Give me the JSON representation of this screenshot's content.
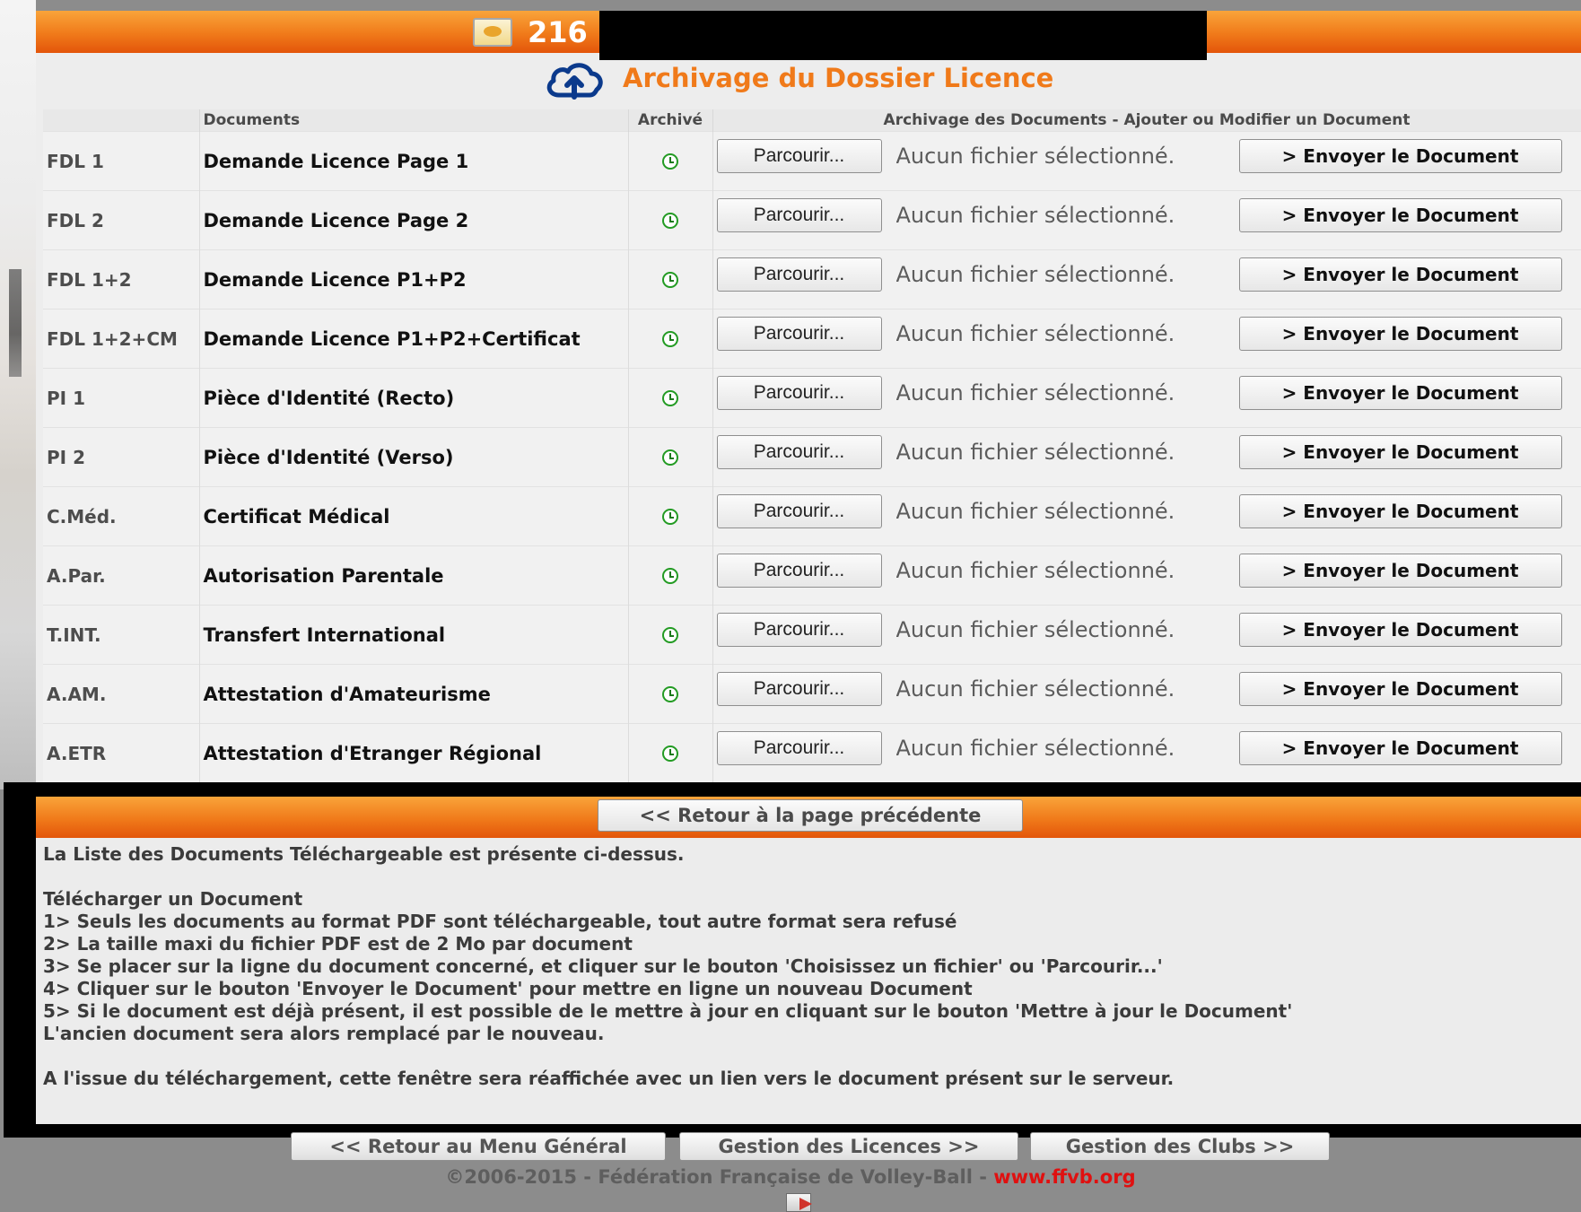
{
  "header": {
    "title_visible": "216",
    "subtitle": "Archivage du Dossier Licence"
  },
  "table": {
    "headers": {
      "code": "",
      "documents": "Documents",
      "archived": "Archivé",
      "actions": "Archivage des Documents - Ajouter ou Modifier un Document"
    },
    "browse_label": "Parcourir...",
    "no_file_label": "Aucun fichier sélectionné.",
    "send_label": "> Envoyer le Document",
    "rows": [
      {
        "code": "FDL 1",
        "label": "Demande Licence Page 1"
      },
      {
        "code": "FDL 2",
        "label": "Demande Licence Page 2"
      },
      {
        "code": "FDL 1+2",
        "label": "Demande Licence P1+P2"
      },
      {
        "code": "FDL 1+2+CM",
        "label": "Demande Licence P1+P2+Certificat"
      },
      {
        "code": "PI 1",
        "label": "Pièce d'Identité (Recto)"
      },
      {
        "code": "PI 2",
        "label": "Pièce d'Identité (Verso)"
      },
      {
        "code": "C.Méd.",
        "label": "Certificat Médical"
      },
      {
        "code": "A.Par.",
        "label": "Autorisation Parentale"
      },
      {
        "code": "T.INT.",
        "label": "Transfert International"
      },
      {
        "code": "A.AM.",
        "label": "Attestation d'Amateurisme"
      },
      {
        "code": "A.ETR",
        "label": "Attestation d'Etranger Régional"
      }
    ]
  },
  "info": {
    "back_button": "<< Retour à la page précédente",
    "intro": "La Liste des Documents Téléchargeable est présente ci-dessus.",
    "heading": "Télécharger un Document",
    "steps": [
      "1> Seuls les documents au format PDF sont téléchargeable, tout autre format sera refusé",
      "2> La taille maxi du fichier PDF est de 2 Mo par document",
      "3> Se placer sur la ligne du document concerné, et cliquer sur le bouton 'Choisissez un fichier' ou 'Parcourir...'",
      "4> Cliquer sur le bouton 'Envoyer le Document' pour mettre en ligne un nouveau Document",
      "5> Si le document est déjà présent, il est possible de le mettre à jour en cliquant sur le bouton 'Mettre à jour le Document'"
    ],
    "replace_note": "L'ancien document sera alors remplacé par le nouveau.",
    "outro": "A l'issue du téléchargement, cette fenêtre sera réaffichée avec un lien vers le document présent sur le serveur."
  },
  "footer": {
    "menu_button": "<< Retour au Menu Général",
    "licences_button": "Gestion des Licences >>",
    "clubs_button": "Gestion des Clubs >>",
    "copyright": "©2006-2015 - Fédération Française de Volley-Ball - ",
    "site_link": "www.ffvb.org"
  },
  "colors": {
    "accent_orange": "#f07a1a",
    "archived_icon_green": "#239b23",
    "link_red": "#e01010"
  }
}
